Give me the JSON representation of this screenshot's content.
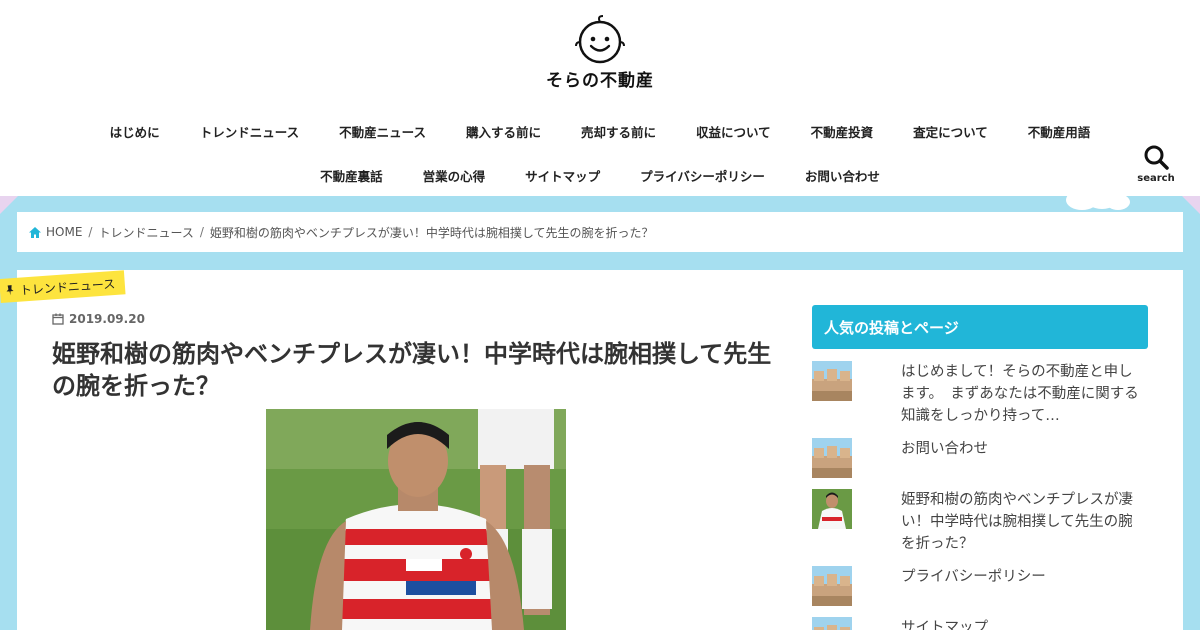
{
  "site": {
    "logo_text": "そらの不動産"
  },
  "nav": {
    "row1": [
      "はじめに",
      "トレンドニュース",
      "不動産ニュース",
      "購入する前に",
      "売却する前に",
      "収益について",
      "不動産投資",
      "査定について",
      "不動産用語"
    ],
    "row2": [
      "不動産裏話",
      "営業の心得",
      "サイトマップ",
      "プライバシーポリシー",
      "お問い合わせ"
    ]
  },
  "search": {
    "label": "search",
    "icon": "search-icon"
  },
  "breadcrumb": {
    "home": "HOME",
    "category": "トレンドニュース",
    "current": "姫野和樹の筋肉やベンチプレスが凄い！中学時代は腕相撲して先生の腕を折った？"
  },
  "post": {
    "category": "トレンドニュース",
    "date": "2019.09.20",
    "title": "姫野和樹の筋肉やベンチプレスが凄い！中学時代は腕相撲して先生の腕を折った？"
  },
  "sidebar": {
    "widget_title": "人気の投稿とページ",
    "items": [
      {
        "text": "はじめまして！そらの不動産と申します。　まずあなたは不動産に関する知識をしっかり持って…",
        "thumb": "building"
      },
      {
        "text": "お問い合わせ",
        "thumb": "building"
      },
      {
        "text": "姫野和樹の筋肉やベンチプレスが凄い！中学時代は腕相撲して先生の腕を折った？",
        "thumb": "rugby"
      },
      {
        "text": "プライバシーポリシー",
        "thumb": "building"
      },
      {
        "text": "サイトマップ",
        "thumb": "building"
      }
    ]
  },
  "colors": {
    "band": "#a6dff0",
    "widget": "#21b6d8",
    "tag": "#fde43e",
    "accent": "#21b6d8"
  }
}
